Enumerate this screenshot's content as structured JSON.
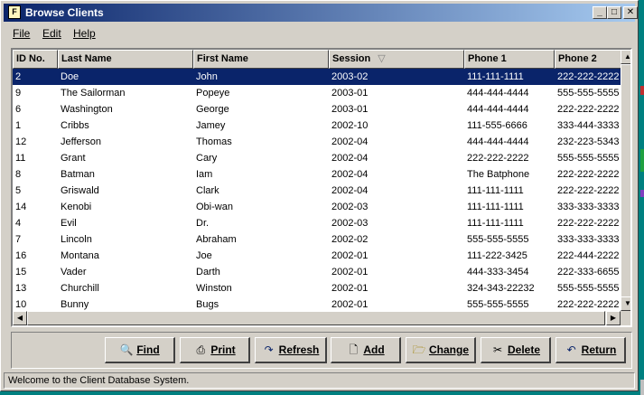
{
  "window": {
    "title": "Browse Clients"
  },
  "menu": [
    {
      "label": "File"
    },
    {
      "label": "Edit"
    },
    {
      "label": "Help"
    }
  ],
  "table": {
    "columns": [
      "ID No.",
      "Last Name",
      "First Name",
      "Session",
      "Phone 1",
      "Phone 2"
    ],
    "sort_column": "Session",
    "sort_indicator": "▽",
    "selected_row": 0,
    "rows": [
      [
        "2",
        "Doe",
        "John",
        "2003-02",
        "111-111-1111",
        "222-222-2222"
      ],
      [
        "9",
        "The Sailorman",
        "Popeye",
        "2003-01",
        "444-444-4444",
        "555-555-5555"
      ],
      [
        "6",
        "Washington",
        "George",
        "2003-01",
        "444-444-4444",
        "222-222-2222"
      ],
      [
        "1",
        "Cribbs",
        "Jamey",
        "2002-10",
        "111-555-6666",
        "333-444-3333"
      ],
      [
        "12",
        "Jefferson",
        "Thomas",
        "2002-04",
        "444-444-4444",
        "232-223-5343"
      ],
      [
        "11",
        "Grant",
        "Cary",
        "2002-04",
        "222-222-2222",
        "555-555-5555"
      ],
      [
        "8",
        "Batman",
        "Iam",
        "2002-04",
        "The Batphone",
        "222-222-2222"
      ],
      [
        "5",
        "Griswald",
        "Clark",
        "2002-04",
        "111-111-1111",
        "222-222-2222"
      ],
      [
        "14",
        "Kenobi",
        "Obi-wan",
        "2002-03",
        "111-111-1111",
        "333-333-3333"
      ],
      [
        "4",
        "Evil",
        "Dr.",
        "2002-03",
        "111-111-1111",
        "222-222-2222"
      ],
      [
        "7",
        "Lincoln",
        "Abraham",
        "2002-02",
        "555-555-5555",
        "333-333-3333"
      ],
      [
        "16",
        "Montana",
        "Joe",
        "2002-01",
        "111-222-3425",
        "222-444-2222"
      ],
      [
        "15",
        "Vader",
        "Darth",
        "2002-01",
        "444-333-3454",
        "222-333-6655"
      ],
      [
        "13",
        "Churchill",
        "Winston",
        "2002-01",
        "324-343-22232",
        "555-555-5555"
      ],
      [
        "10",
        "Bunny",
        "Bugs",
        "2002-01",
        "555-555-5555",
        "222-222-2222"
      ]
    ]
  },
  "buttons": [
    {
      "label": "Find",
      "icon": "magnifier-icon"
    },
    {
      "label": "Print",
      "icon": "printer-icon"
    },
    {
      "label": "Refresh",
      "icon": "refresh-arrow-icon"
    },
    {
      "label": "Add",
      "icon": "new-document-icon"
    },
    {
      "label": "Change",
      "icon": "open-folder-icon"
    },
    {
      "label": "Delete",
      "icon": "scissors-icon"
    },
    {
      "label": "Return",
      "icon": "return-arrow-icon"
    }
  ],
  "status": {
    "text": "Welcome to the Client Database System."
  },
  "colors": {
    "selection": "#0a246a",
    "face": "#d4d0c8",
    "titlebar_start": "#0a246a",
    "titlebar_end": "#a6caf0"
  }
}
